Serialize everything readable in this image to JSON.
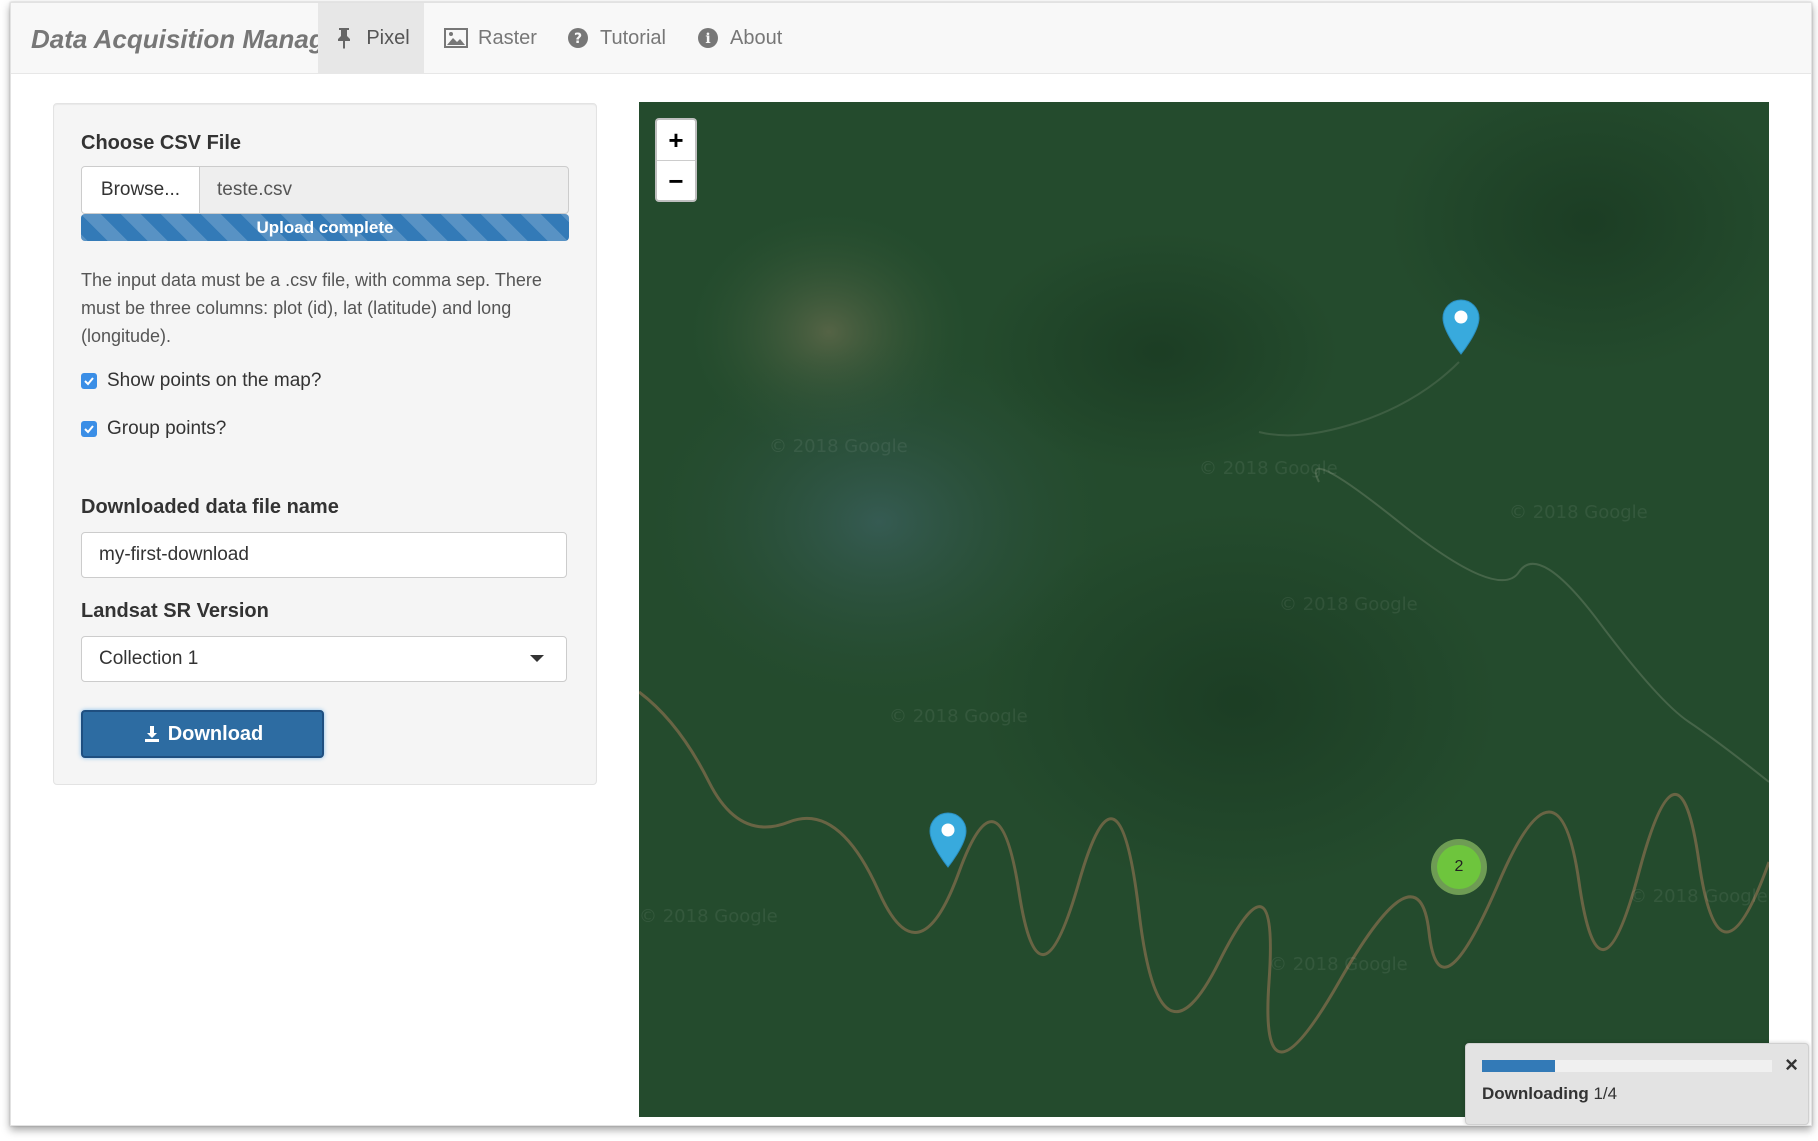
{
  "navbar": {
    "brand": "Data Acquisition Manager",
    "tabs": [
      {
        "label": "Pixel",
        "icon": "thumbtack-icon",
        "active": true
      },
      {
        "label": "Raster",
        "icon": "image-icon",
        "active": false
      },
      {
        "label": "Tutorial",
        "icon": "question-circle-icon",
        "active": false
      },
      {
        "label": "About",
        "icon": "info-circle-icon",
        "active": false
      }
    ]
  },
  "sidebar": {
    "csv_label": "Choose CSV File",
    "browse_label": "Browse...",
    "file_name": "teste.csv",
    "upload_status": "Upload complete",
    "upload_progress": 1.0,
    "help_text": "The input data must be a .csv file, with comma sep. There must be three columns: plot (id), lat (latitude) and long (longitude).",
    "show_points_label": "Show points on the map?",
    "show_points_checked": true,
    "group_points_label": "Group points?",
    "group_points_checked": true,
    "filename_label": "Downloaded data file name",
    "filename_value": "my-first-download",
    "version_label": "Landsat SR Version",
    "version_selected": "Collection 1",
    "download_label": "Download"
  },
  "map": {
    "zoom_in": "+",
    "zoom_out": "−",
    "cluster_count": "2",
    "attribution_watermark": "© 2018 Google",
    "marker_color": "#38aadd",
    "cluster_color": "#6ecc39"
  },
  "notification": {
    "status": "Downloading",
    "progress_text": "1/4",
    "progress": 0.25,
    "close": "×"
  },
  "colors": {
    "primary": "#337ab7",
    "navbar_bg": "#f8f8f8",
    "map_base": "#234a2c"
  }
}
